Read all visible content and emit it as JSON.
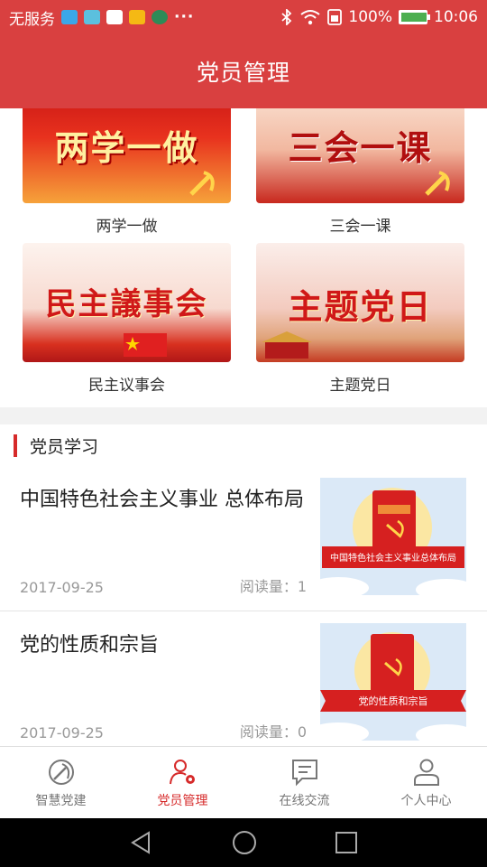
{
  "status_bar": {
    "carrier": "无服务",
    "more": "···",
    "battery": "100%",
    "time": "10:06"
  },
  "header": {
    "title": "党员管理"
  },
  "grid": [
    {
      "label": "两学一做",
      "banner_text": "两学一做"
    },
    {
      "label": "三会一课",
      "banner_text": "三会一课"
    },
    {
      "label": "民主议事会",
      "banner_text": "民主議事会"
    },
    {
      "label": "主题党日",
      "banner_text": "主题党日"
    }
  ],
  "study": {
    "section_title": "党员学习",
    "articles": [
      {
        "title": "中国特色社会主义事业 总体布局",
        "date": "2017-09-25",
        "reads": "阅读量：1",
        "thumb_caption": "中国特色社会主义事业总体布局"
      },
      {
        "title": "党的性质和宗旨",
        "date": "2017-09-25",
        "reads": "阅读量：0",
        "thumb_caption": "党的性质和宗旨"
      }
    ]
  },
  "tabs": [
    {
      "label": "智慧党建",
      "icon": "party-emblem-icon",
      "active": false
    },
    {
      "label": "党员管理",
      "icon": "user-gear-icon",
      "active": true
    },
    {
      "label": "在线交流",
      "icon": "chat-icon",
      "active": false
    },
    {
      "label": "个人中心",
      "icon": "person-icon",
      "active": false
    }
  ],
  "colors": {
    "primary": "#d94040",
    "accent": "#d62a2a"
  }
}
